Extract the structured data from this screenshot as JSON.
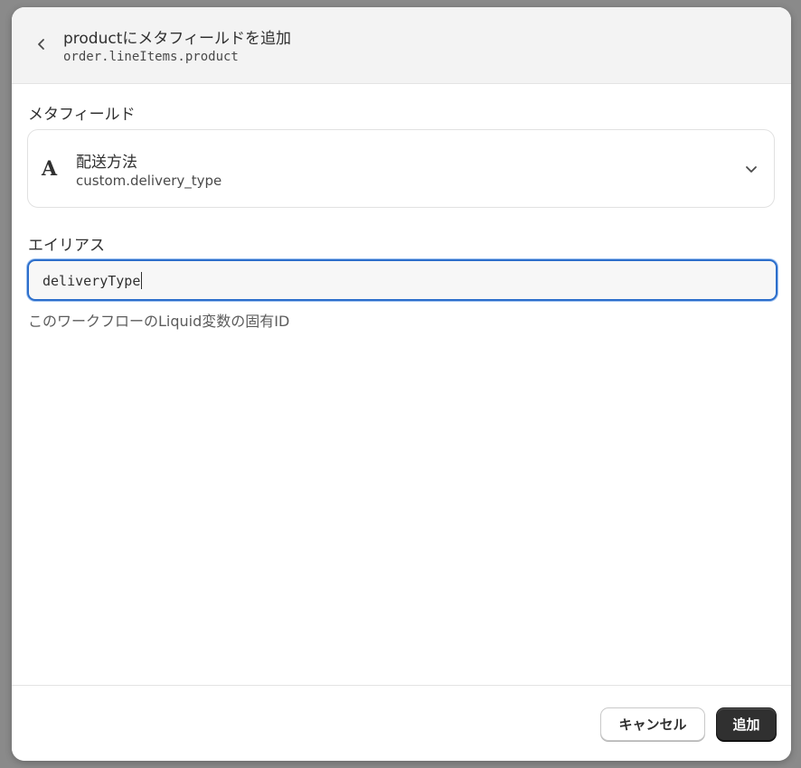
{
  "header": {
    "back_icon": "chevron-left-icon",
    "title": "productにメタフィールドを追加",
    "subtitle": "order.lineItems.product"
  },
  "metafield": {
    "label": "メタフィールド",
    "type_icon": "A",
    "name": "配送方法",
    "key": "custom.delivery_type",
    "chevron_icon": "chevron-down-icon"
  },
  "alias": {
    "label": "エイリアス",
    "value": "deliveryType",
    "help_text": "このワークフローのLiquid変数の固有ID",
    "focus_color": "#2c6ecb"
  },
  "footer": {
    "cancel_label": "キャンセル",
    "add_label": "追加"
  },
  "colors": {
    "primary_button": "#303030",
    "header_background": "#f3f3f3",
    "backdrop": "#8a8a8a"
  }
}
